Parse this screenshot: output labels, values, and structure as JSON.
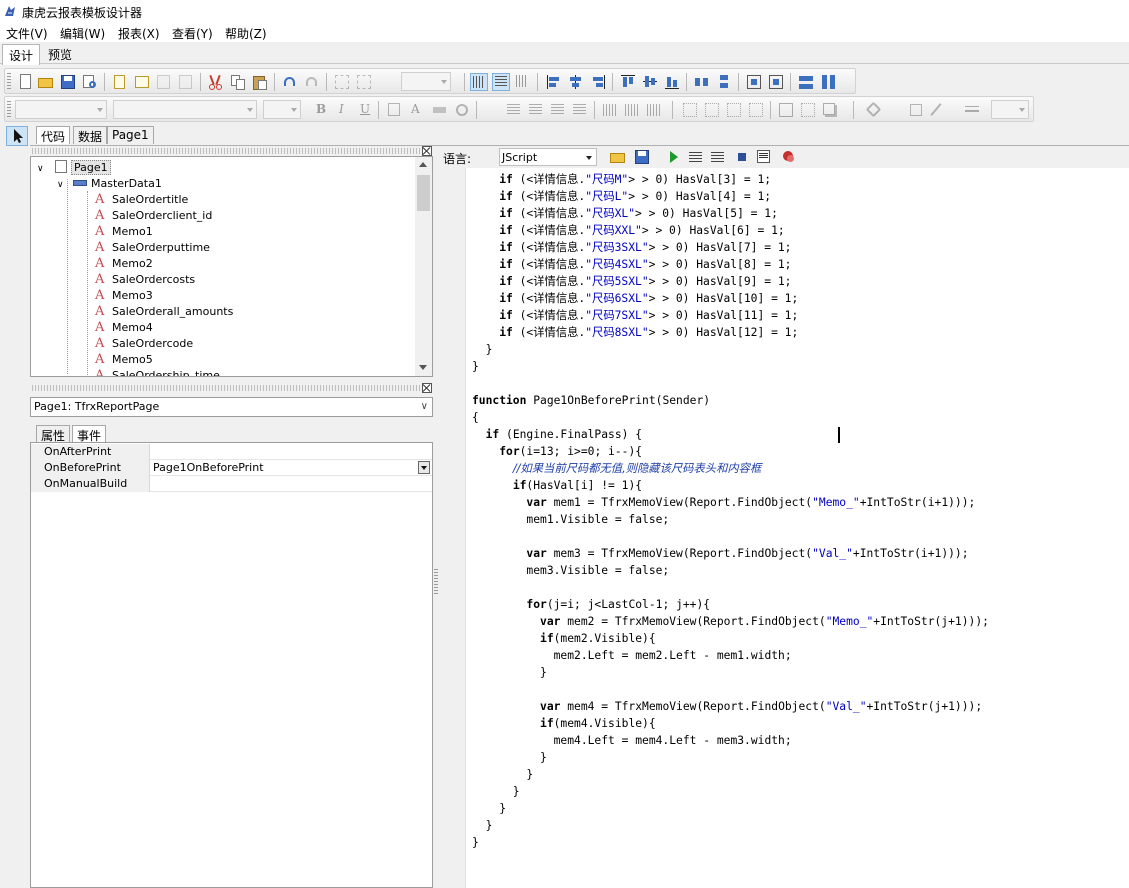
{
  "app": {
    "title": "康虎云报表模板设计器"
  },
  "menu": [
    "文件(V)",
    "编辑(W)",
    "报表(X)",
    "查看(Y)",
    "帮助(Z)"
  ],
  "mode_tabs": [
    "设计",
    "预览"
  ],
  "panel_tabs": [
    "代码",
    "数据",
    "Page1"
  ],
  "tree": {
    "root": "Page1",
    "band": "MasterData1",
    "items": [
      "SaleOrdertitle",
      "SaleOrderclient_id",
      "Memo1",
      "SaleOrderputtime",
      "Memo2",
      "SaleOrdercosts",
      "Memo3",
      "SaleOrderall_amounts",
      "Memo4",
      "SaleOrdercode",
      "Memo5",
      "SaleOrdership_time"
    ]
  },
  "object_combo": "Page1: TfrxReportPage",
  "prop_tabs": [
    "属性",
    "事件"
  ],
  "events": [
    {
      "name": "OnAfterPrint",
      "value": ""
    },
    {
      "name": "OnBeforePrint",
      "value": "Page1OnBeforePrint"
    },
    {
      "name": "OnManualBuild",
      "value": ""
    }
  ],
  "code_toolbar": {
    "lang_label": "语言:",
    "lang_value": "JScript"
  },
  "code_lines": [
    "    if (<详情信息.\"尺码M\"> > 0) HasVal[3] = 1;",
    "    if (<详情信息.\"尺码L\"> > 0) HasVal[4] = 1;",
    "    if (<详情信息.\"尺码XL\"> > 0) HasVal[5] = 1;",
    "    if (<详情信息.\"尺码XXL\"> > 0) HasVal[6] = 1;",
    "    if (<详情信息.\"尺码3SXL\"> > 0) HasVal[7] = 1;",
    "    if (<详情信息.\"尺码4SXL\"> > 0) HasVal[8] = 1;",
    "    if (<详情信息.\"尺码5SXL\"> > 0) HasVal[9] = 1;",
    "    if (<详情信息.\"尺码6SXL\"> > 0) HasVal[10] = 1;",
    "    if (<详情信息.\"尺码7SXL\"> > 0) HasVal[11] = 1;",
    "    if (<详情信息.\"尺码8SXL\"> > 0) HasVal[12] = 1;",
    "  }",
    "}",
    "",
    "function Page1OnBeforePrint(Sender)",
    "{",
    "  if (Engine.FinalPass) {",
    "    for(i=13; i>=0; i--){",
    "      //如果当前尺码都无值,则隐藏该尺码表头和内容框",
    "      if(HasVal[i] != 1){",
    "        var mem1 = TfrxMemoView(Report.FindObject(\"Memo_\"+IntToStr(i+1)));",
    "        mem1.Visible = false;",
    "",
    "        var mem3 = TfrxMemoView(Report.FindObject(\"Val_\"+IntToStr(i+1)));",
    "        mem3.Visible = false;",
    "",
    "        for(j=i; j<LastCol-1; j++){",
    "          var mem2 = TfrxMemoView(Report.FindObject(\"Memo_\"+IntToStr(j+1)));",
    "          if(mem2.Visible){",
    "            mem2.Left = mem2.Left - mem1.width;",
    "          }",
    "",
    "          var mem4 = TfrxMemoView(Report.FindObject(\"Val_\"+IntToStr(j+1)));",
    "          if(mem4.Visible){",
    "            mem4.Left = mem4.Left - mem3.width;",
    "          }",
    "        }",
    "      }",
    "    }",
    "  }",
    "}"
  ]
}
